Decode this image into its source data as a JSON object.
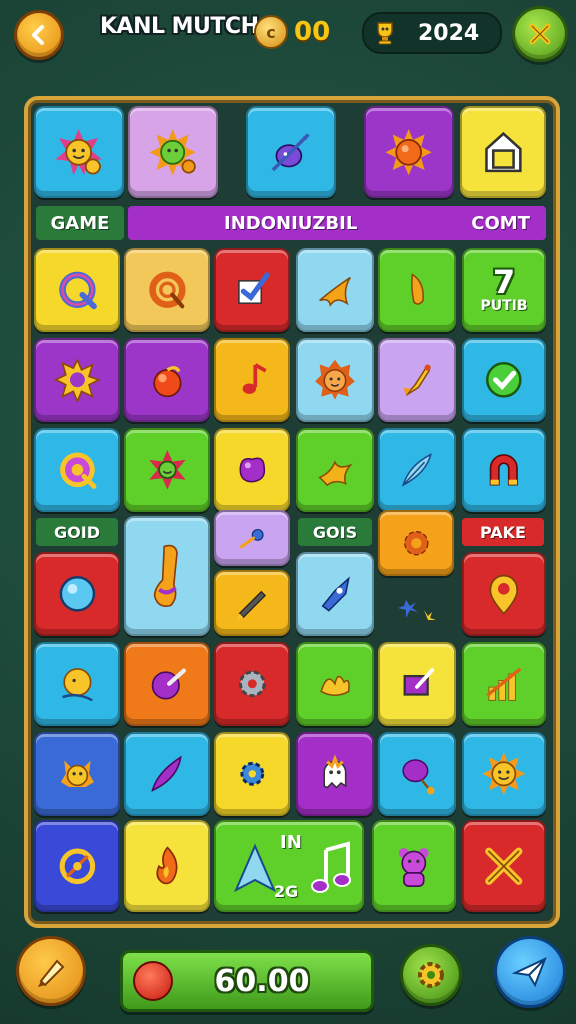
{
  "header": {
    "title": "KANL MUTCH",
    "coins": "00",
    "coin_symbol": "c",
    "score": "2024"
  },
  "labels": {
    "game": "GAME",
    "banner": "INDONIUZBIL",
    "comt": "COMT",
    "gold": "GOID",
    "gois": "GOIS",
    "pake": "PAKE"
  },
  "tiles": {
    "row1_t6_number": "7",
    "row1_t6_caption": "PUTIB",
    "special_in": "IN",
    "special_2g": "2G"
  },
  "footer": {
    "value": "60.00"
  },
  "colors": {
    "accent_gold": "#d8a53a",
    "board_bg": "#1e3d34",
    "page_bg": "#1e4a3b",
    "coin_text": "#f7c515"
  },
  "icons": [
    "back-arrow-icon",
    "close-x-icon",
    "coin-icon",
    "trophy-icon",
    "pencil-icon",
    "gear-icon",
    "paper-plane-icon"
  ]
}
